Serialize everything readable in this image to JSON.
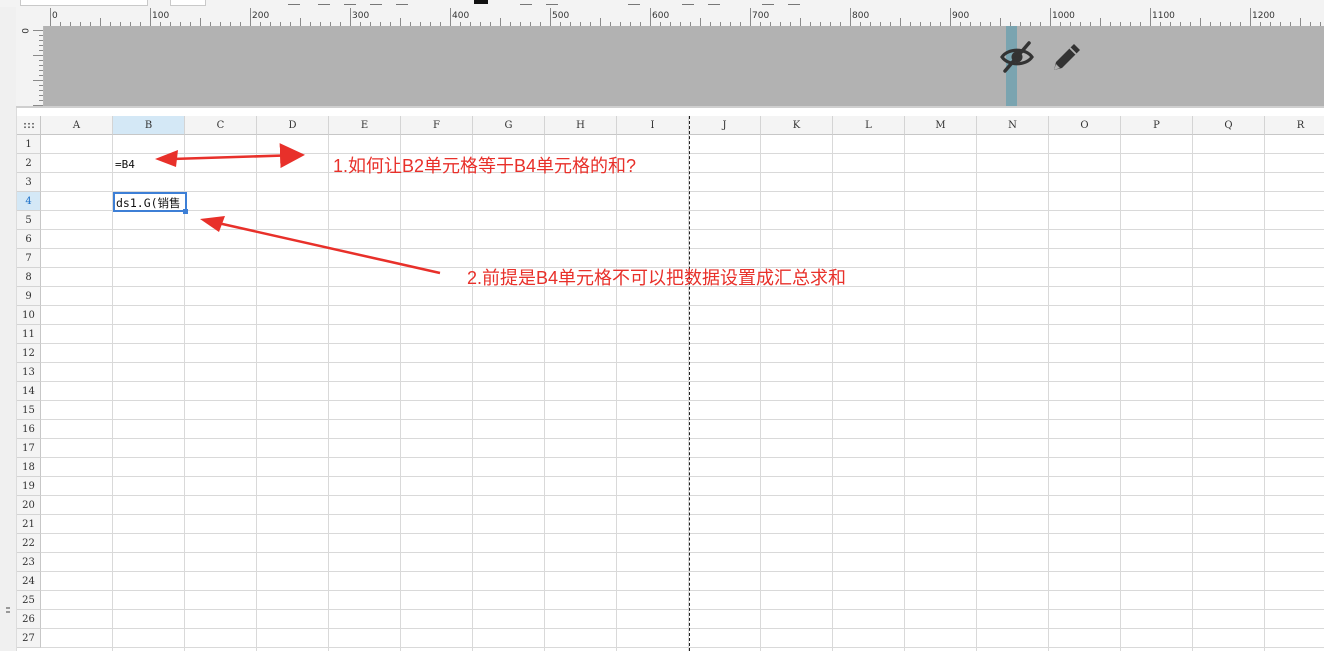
{
  "ruler": {
    "labels": [
      "0",
      "100",
      "200",
      "300",
      "400",
      "500",
      "600",
      "700",
      "800",
      "900",
      "1000",
      "1100",
      "1200"
    ]
  },
  "vertical_ruler": {
    "label": "0"
  },
  "header_band": {
    "marker_color": "#7aa4b0",
    "icons": [
      "eye-slash-icon",
      "pencil-icon"
    ]
  },
  "sheet": {
    "columns": [
      "A",
      "B",
      "C",
      "D",
      "E",
      "F",
      "G",
      "H",
      "I",
      "J",
      "K",
      "L",
      "M",
      "N",
      "O",
      "P",
      "Q",
      "R"
    ],
    "rows": [
      "1",
      "2",
      "3",
      "4",
      "5",
      "6",
      "7",
      "8",
      "9",
      "10",
      "11",
      "12",
      "13",
      "14",
      "15",
      "16",
      "17",
      "18",
      "19",
      "20",
      "21",
      "22",
      "23",
      "24",
      "25",
      "26",
      "27"
    ],
    "selected_column": "B",
    "selected_row": "4",
    "cells": {
      "B2": "=B4",
      "B4": "ds1.G(销售"
    }
  },
  "annotations": {
    "note1": "1.如何让B2单元格等于B4单元格的和?",
    "note2": "2.前提是B4单元格不可以把数据设置成汇总求和",
    "color": "#e8302a"
  }
}
